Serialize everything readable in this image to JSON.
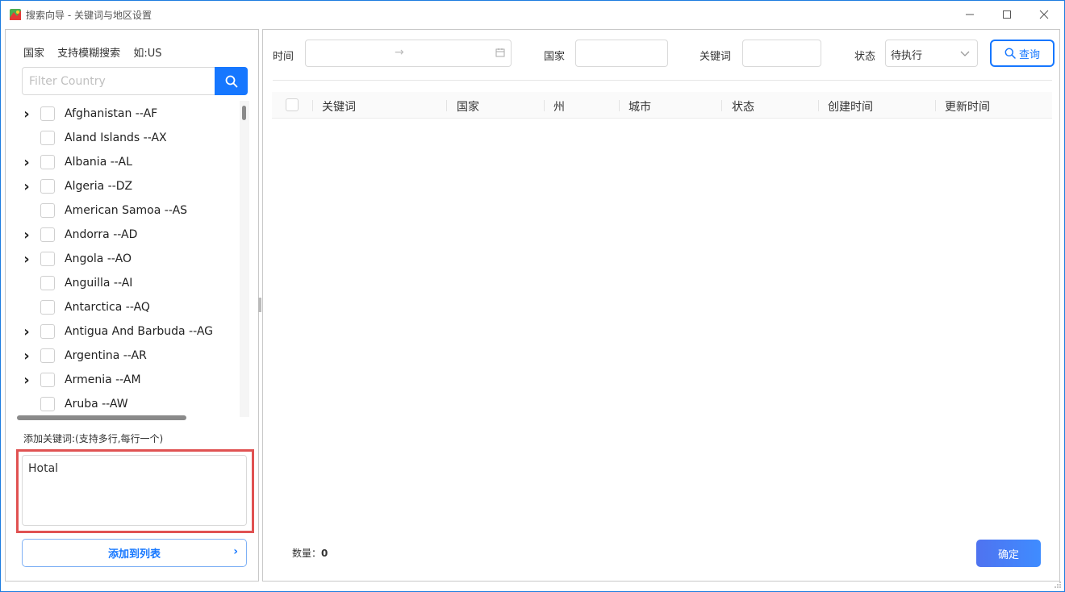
{
  "window": {
    "title": "搜索向导 - 关键词与地区设置"
  },
  "left": {
    "hint": [
      "国家",
      "支持模糊搜索",
      "如:US"
    ],
    "filter_placeholder": "Filter Country",
    "countries": [
      {
        "label": "Afghanistan --AF",
        "expandable": true
      },
      {
        "label": "Aland Islands --AX",
        "expandable": false
      },
      {
        "label": "Albania --AL",
        "expandable": true
      },
      {
        "label": "Algeria --DZ",
        "expandable": true
      },
      {
        "label": "American Samoa --AS",
        "expandable": false
      },
      {
        "label": "Andorra --AD",
        "expandable": true
      },
      {
        "label": "Angola --AO",
        "expandable": true
      },
      {
        "label": "Anguilla --AI",
        "expandable": false
      },
      {
        "label": "Antarctica --AQ",
        "expandable": false
      },
      {
        "label": "Antigua And Barbuda --AG",
        "expandable": true
      },
      {
        "label": "Argentina --AR",
        "expandable": true
      },
      {
        "label": "Armenia --AM",
        "expandable": true
      },
      {
        "label": "Aruba --AW",
        "expandable": false
      }
    ],
    "keyword_label": "添加关键词:(支持多行,每行一个)",
    "keyword_value": "Hotal",
    "add_button": "添加到列表"
  },
  "right": {
    "filters": {
      "time_label": "时间",
      "country_label": "国家",
      "keyword_label": "关键词",
      "status_label": "状态",
      "status_value": "待执行",
      "query_button": "查询"
    },
    "columns": [
      "关键词",
      "国家",
      "州",
      "城市",
      "状态",
      "创建时间",
      "更新时间"
    ],
    "count_label": "数量：",
    "count_value": "0",
    "ok_button": "确定"
  },
  "colors": {
    "accent": "#1677ff",
    "highlight": "#e05252",
    "window_border": "#1d7ce0"
  }
}
